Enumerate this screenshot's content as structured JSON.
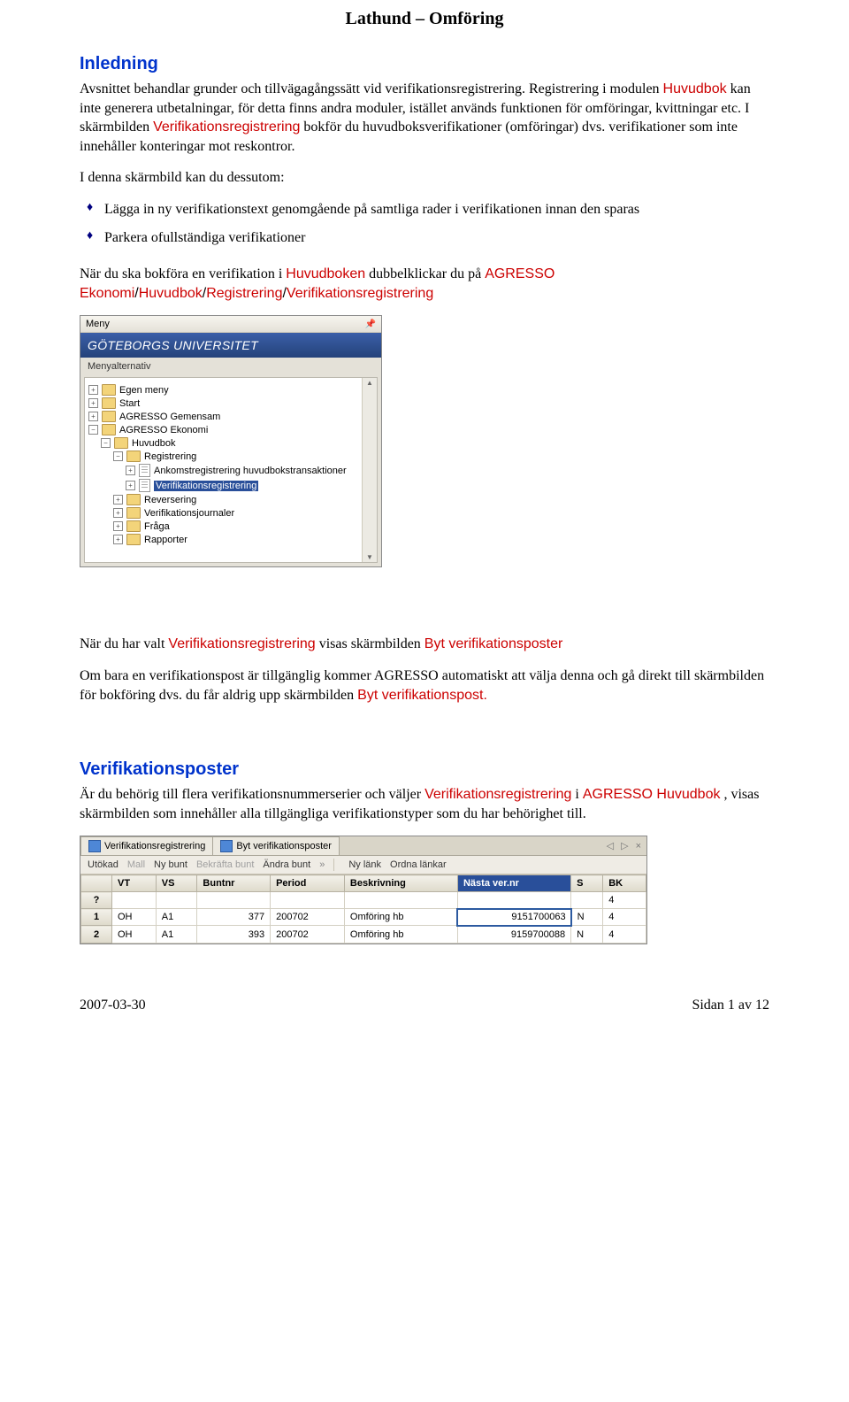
{
  "doc": {
    "title": "Lathund – Omföring",
    "section_intro": "Inledning",
    "p1a": "Avsnittet behandlar grunder och tillvägagångssätt vid verifikationsregistrering. Registrering i modulen ",
    "p1_red1": "Huvudbok",
    "p1b": " kan inte generera utbetalningar, för detta finns andra moduler, istället används funktionen för omföringar, kvittningar etc. I skärmbilden ",
    "p1_red2": "Verifikationsregistrering",
    "p1c": " bokför du huvudboksverifikationer (omföringar) dvs. verifikationer som inte innehåller konteringar mot reskontror.",
    "p2": "I denna skärmbild kan du dessutom:",
    "li1": "Lägga in ny verifikationstext genomgående på samtliga rader i verifikationen innan den sparas",
    "li2": "Parkera ofullständiga verifikationer",
    "p3a": "När du ska bokföra en verifikation i ",
    "p3_red1": "Huvudboken",
    "p3b": " dubbelklickar du på ",
    "p3_red2": "AGRESSO Ekonomi",
    "p3_red3": "Huvudbok",
    "p3_red4": "Registrering",
    "p3_red5": "Verifikationsregistrering",
    "p4a": "När du har valt ",
    "p4_red1": "Verifikationsregistrering",
    "p4b": " visas skärmbilden ",
    "p4_red2": "Byt verifikationsposter",
    "p5a": "Om bara en verifikationspost är tillgänglig kommer AGRESSO automatiskt att välja denna och gå direkt till skärmbilden för bokföring dvs. du får aldrig upp skärmbilden ",
    "p5_red1": "Byt verifikationspost.",
    "section_ver": "Verifikationsposter",
    "p6a": "Är du behörig till flera verifikationsnummerserier och väljer ",
    "p6_red1": "Verifikationsregistrering",
    "p6b": " i ",
    "p6_red2": "AGRESSO Huvudbok",
    "p6c": ", visas skärmbilden som innehåller alla tillgängliga verifikationstyper som du har behörighet till."
  },
  "shot1": {
    "panel": "Meny",
    "org": "GÖTEBORGS UNIVERSITET",
    "sub": "Menyalternativ",
    "items": [
      "Egen meny",
      "Start",
      "AGRESSO Gemensam",
      "AGRESSO Ekonomi",
      "Huvudbok",
      "Registrering",
      "Ankomstregistrering huvudbokstransaktioner",
      "Verifikationsregistrering",
      "Reversering",
      "Verifikationsjournaler",
      "Fråga",
      "Rapporter"
    ]
  },
  "shot2": {
    "tab1": "Verifikationsregistrering",
    "tab2": "Byt verifikationsposter",
    "tb_utokad": "Utökad",
    "tb_mall": "Mall",
    "tb_nybunt": "Ny bunt",
    "tb_bekraftabunt": "Bekräfta bunt",
    "tb_andrabunt": "Ändra bunt",
    "tb_nylank": "Ny länk",
    "tb_ordnalankar": "Ordna länkar",
    "cols": [
      "",
      "VT",
      "VS",
      "Buntnr",
      "Period",
      "Beskrivning",
      "Nästa ver.nr",
      "S",
      "BK"
    ],
    "row_q": [
      "?",
      "",
      "",
      "",
      "",
      "",
      "",
      "",
      "4"
    ],
    "row1": [
      "1",
      "OH",
      "A1",
      "377",
      "200702",
      "Omföring hb",
      "9151700063",
      "N",
      "4"
    ],
    "row2": [
      "2",
      "OH",
      "A1",
      "393",
      "200702",
      "Omföring hb",
      "9159700088",
      "N",
      "4"
    ]
  },
  "footer": {
    "date": "2007-03-30",
    "page": "Sidan 1 av 12"
  }
}
